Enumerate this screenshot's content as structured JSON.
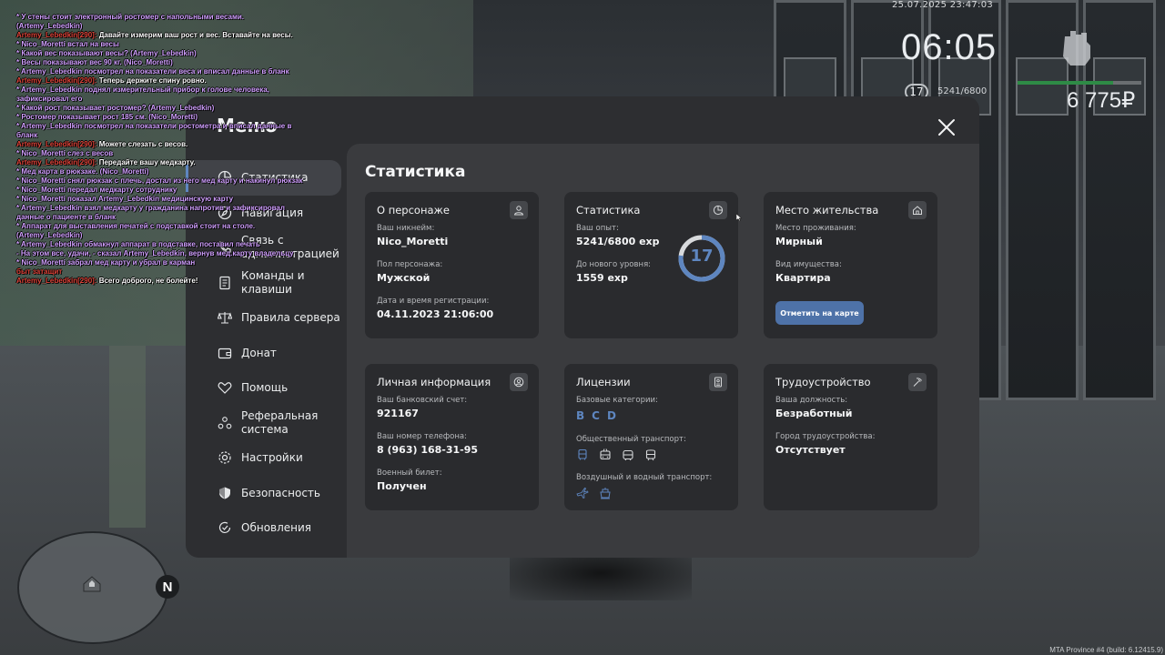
{
  "hud": {
    "datetime": "25.07.2025 23:47:03",
    "clock": "06:05",
    "level": "17",
    "exp": "5241/6800",
    "exp_progress": 0.77,
    "money": "6 775₽",
    "build": "MTA Province #4 (build: 6.12415.9)"
  },
  "chat": [
    {
      "type": "me",
      "text": "* У стены стоит электронный ростомер с напольными весами. (Artemy_Lebedkin)"
    },
    {
      "type": "say",
      "nick": "Artemy_Lebedkin[290]:",
      "text": " Давайте измерим ваш рост и вес. Вставайте на весы."
    },
    {
      "type": "me",
      "text": "* Nico_Moretti встал на весы"
    },
    {
      "type": "me",
      "text": "* Какой вес показывают весы? (Artemy_Lebedkin)"
    },
    {
      "type": "me",
      "text": "* Весы показывают вес 90 кг. (Nico_Moretti)"
    },
    {
      "type": "me",
      "text": "* Artemy_Lebedkin посмотрел на показатели веса и вписал данные в бланк"
    },
    {
      "type": "say",
      "nick": "Artemy_Lebedkin[290]:",
      "text": " Теперь держите спину ровно."
    },
    {
      "type": "me",
      "text": "* Artemy_Lebedkin поднял измерительный прибор к голове человека, зафиксировал его"
    },
    {
      "type": "me",
      "text": "* Какой рост показывает ростомер? (Artemy_Lebedkin)"
    },
    {
      "type": "me",
      "text": "* Ростомер показывает рост 185 см. (Nico_Moretti)"
    },
    {
      "type": "me",
      "text": "* Artemy_Lebedkin посмотрел на показатели ростометра и вписал данные в бланк"
    },
    {
      "type": "say",
      "nick": "Artemy_Lebedkin[290]:",
      "text": " Можете слезать с весов."
    },
    {
      "type": "me",
      "text": "* Nico_Moretti слез с весов"
    },
    {
      "type": "say",
      "nick": "Artemy_Lebedkin[290]:",
      "text": " Передайте вашу медкарту."
    },
    {
      "type": "me",
      "text": "* Мед карта в рюкзаке. (Nico_Moretti)"
    },
    {
      "type": "me",
      "text": "* Nico_Moretti снял рюкзак с плечь, достал из него мед карту и накинул рюкзак"
    },
    {
      "type": "me",
      "text": "* Nico_Moretti передал медкарту сотруднику"
    },
    {
      "type": "me",
      "text": "* Nico_Moretti показал Artemy_Lebedkin медицинскую карту"
    },
    {
      "type": "me",
      "text": "* Artemy_Lebedkin взял медкарту у гражданина напротив и зафиксировал данные о пациенте в бланк"
    },
    {
      "type": "me",
      "text": "* Аппарат для выставления печатей с подставкой стоит на столе. (Artemy_Lebedkin)"
    },
    {
      "type": "me",
      "text": "* Artemy_Lebedkin обмакнул аппарат в подставке, поставил печать"
    },
    {
      "type": "me",
      "text": "- На этом все, удачи, - сказал Artemy_Lebedkin, вернув мед.карту владельцу"
    },
    {
      "type": "me",
      "text": "* Nico_Moretti забрал мед карту и убрал в карман"
    },
    {
      "type": "say",
      "nick": "быт затащит",
      "text": ""
    },
    {
      "type": "say",
      "nick": "Artemy_Lebedkin[290]:",
      "text": " Всего доброго, не болейте!"
    }
  ],
  "menu": {
    "title": "Меню",
    "nav": [
      {
        "label": "Статистика",
        "active": true
      },
      {
        "label": "Навигация",
        "active": false
      },
      {
        "label": "Связь с администрацией",
        "active": false
      },
      {
        "label": "Команды и клавиши",
        "active": false
      },
      {
        "label": "Правила сервера",
        "active": false
      },
      {
        "label": "Донат",
        "active": false
      },
      {
        "label": "Помощь",
        "active": false
      },
      {
        "label": "Реферальная система",
        "active": false
      },
      {
        "label": "Настройки",
        "active": false
      },
      {
        "label": "Безопасность",
        "active": false
      },
      {
        "label": "Обновления",
        "active": false
      }
    ]
  },
  "stats": {
    "title": "Статистика",
    "character": {
      "title": "О персонаже",
      "nick_label": "Ваш никнейм:",
      "nick": "Nico_Moretti",
      "gender_label": "Пол персонажа:",
      "gender": "Мужской",
      "reg_label": "Дата и время регистрации:",
      "reg": "04.11.2023 21:06:00"
    },
    "statistics": {
      "title": "Статистика",
      "exp_label": "Ваш опыт:",
      "exp": "5241/6800 exp",
      "next_label": "До нового уровня:",
      "next": "1559 exp",
      "level": "17",
      "progress": 0.77
    },
    "residence": {
      "title": "Место жительства",
      "place_label": "Место проживания:",
      "place": "Мирный",
      "property_label": "Вид имущества:",
      "property": "Квартира",
      "map_button": "Отметить на карте"
    },
    "personal": {
      "title": "Личная информация",
      "bank_label": "Ваш банковский счет:",
      "bank": "921167",
      "phone_label": "Ваш номер телефона:",
      "phone": "8 (963) 168-31-95",
      "military_label": "Военный билет:",
      "military": "Получен"
    },
    "licenses": {
      "title": "Лицензии",
      "base_label": "Базовые категории:",
      "categories": [
        "B",
        "C",
        "D"
      ],
      "public_label": "Общественный транспорт:",
      "air_label": "Воздушный и водный транспорт:"
    },
    "employment": {
      "title": "Трудоустройство",
      "position_label": "Ваша должность:",
      "position": "Безработный",
      "city_label": "Город трудоустройства:",
      "city": "Отсутствует"
    }
  }
}
